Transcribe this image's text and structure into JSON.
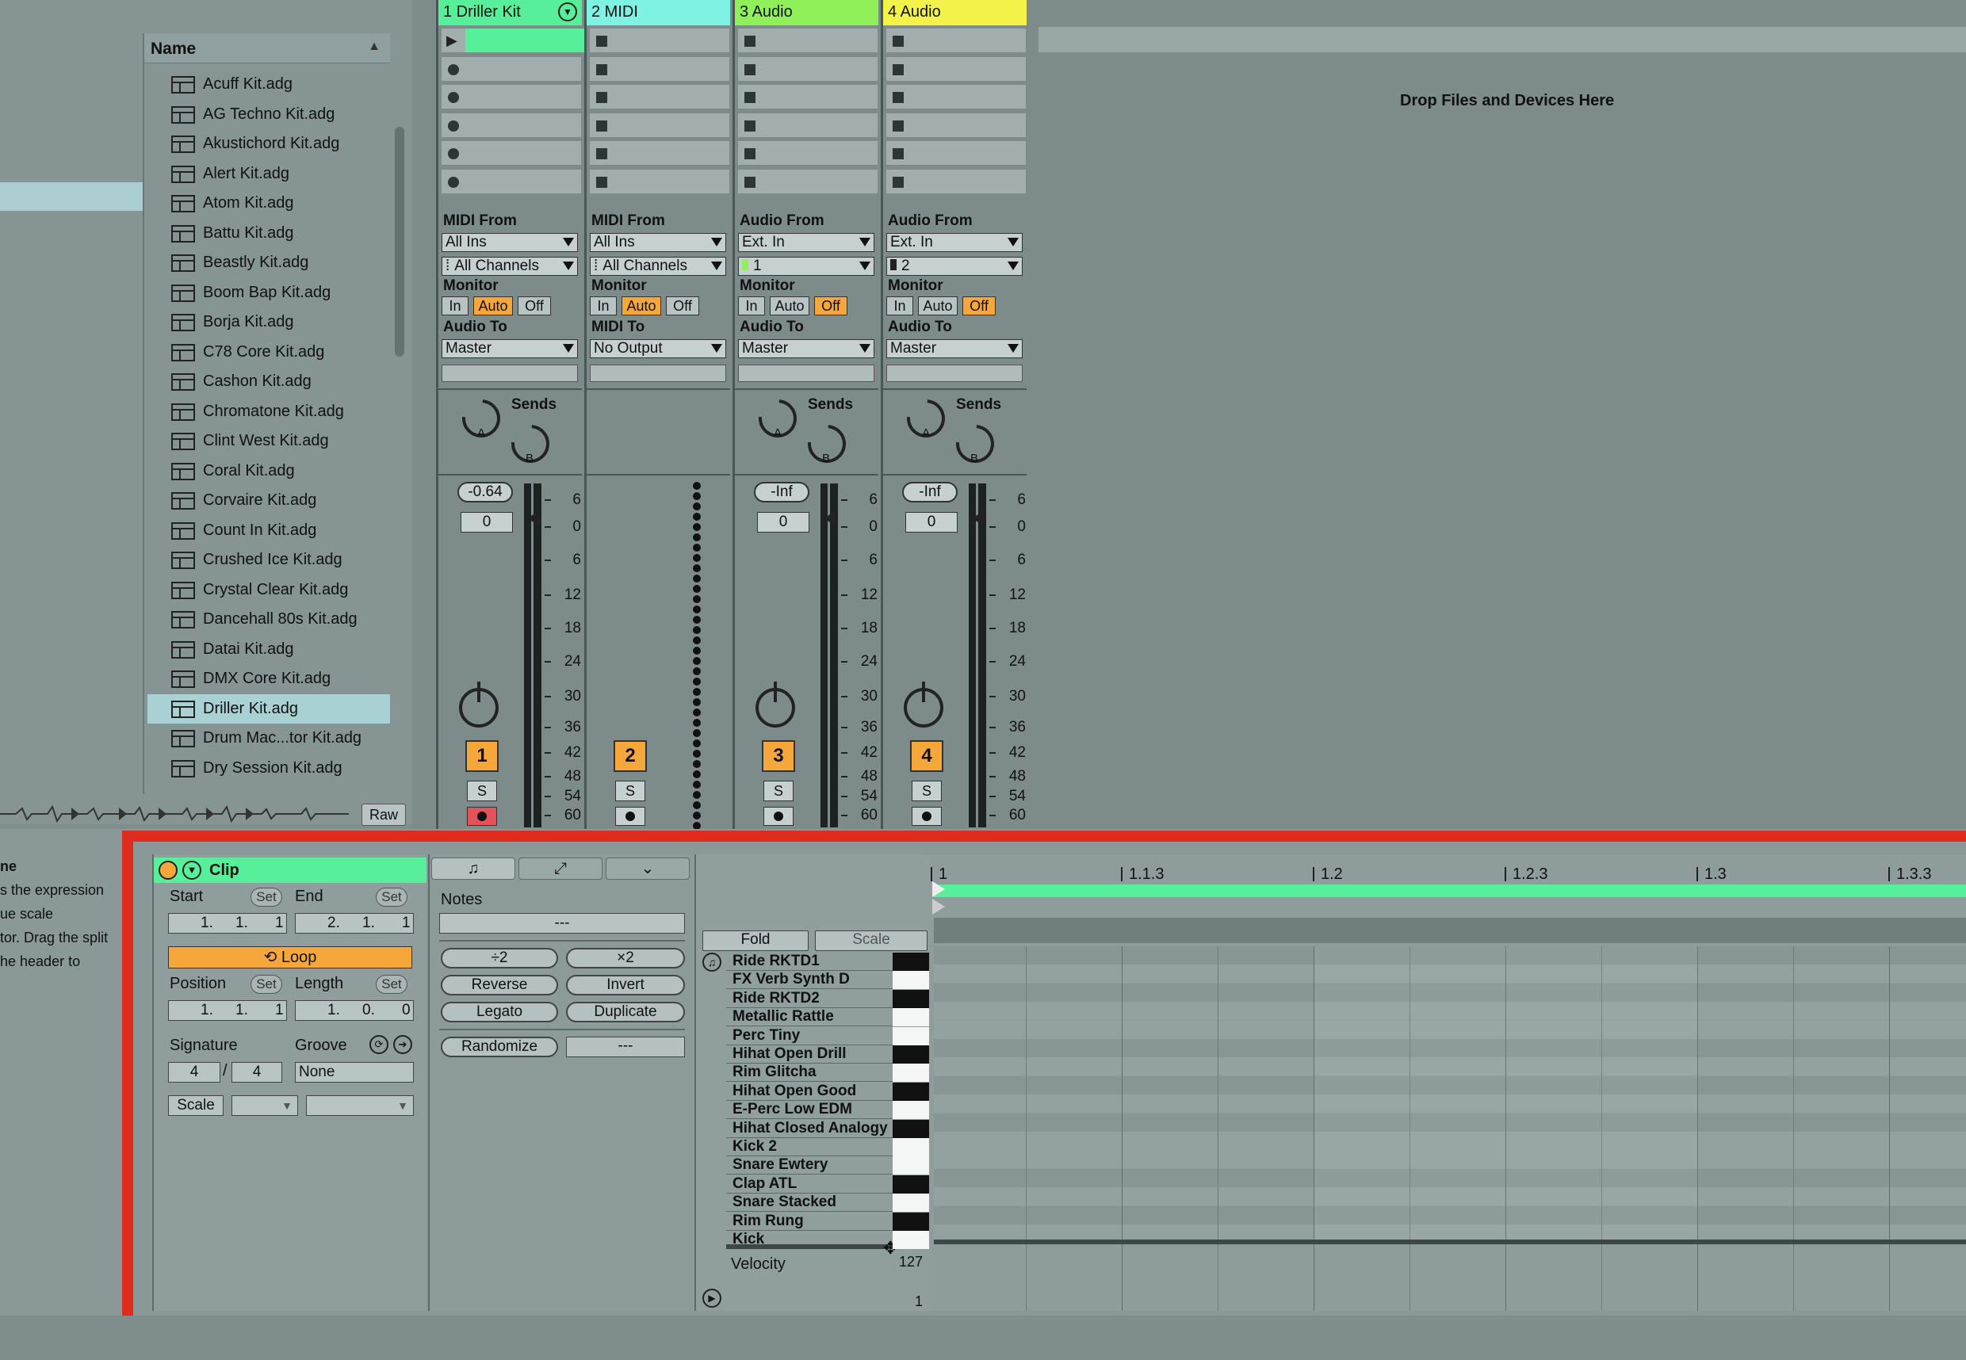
{
  "browser": {
    "column_header": "Name",
    "sort_icon": "triangle-up",
    "items": [
      "Acuff Kit.adg",
      "AG Techno Kit.adg",
      "Akustichord Kit.adg",
      "Alert Kit.adg",
      "Atom Kit.adg",
      "Battu Kit.adg",
      "Beastly Kit.adg",
      "Boom Bap Kit.adg",
      "Borja Kit.adg",
      "C78 Core Kit.adg",
      "Cashon Kit.adg",
      "Chromatone Kit.adg",
      "Clint West Kit.adg",
      "Coral Kit.adg",
      "Corvaire Kit.adg",
      "Count In Kit.adg",
      "Crushed Ice Kit.adg",
      "Crystal Clear Kit.adg",
      "Dancehall 80s Kit.adg",
      "Datai Kit.adg",
      "DMX Core Kit.adg",
      "Driller Kit.adg",
      "Drum Mac...tor Kit.adg",
      "Dry Session Kit.adg"
    ],
    "selected_item": "Driller Kit.adg",
    "raw_button": "Raw"
  },
  "tracks": [
    {
      "title": "1 Driller Kit",
      "color": "#58ef9b",
      "type": "midi",
      "from_label": "MIDI From",
      "from_value": "All Ins",
      "channel_value": "All Channels",
      "monitor_label": "Monitor",
      "monitor": [
        "In",
        "Auto",
        "Off"
      ],
      "monitor_active": "Auto",
      "to_label": "Audio To",
      "to_value": "Master",
      "sends_label": "Sends",
      "volume": "-0.64",
      "pan": "0",
      "number": "1",
      "solo": "S",
      "armed": true
    },
    {
      "title": "2 MIDI",
      "color": "#7ff3e3",
      "type": "midi",
      "from_label": "MIDI From",
      "from_value": "All Ins",
      "channel_value": "All Channels",
      "monitor_label": "Monitor",
      "monitor": [
        "In",
        "Auto",
        "Off"
      ],
      "monitor_active": "Auto",
      "to_label": "MIDI To",
      "to_value": "No Output",
      "number": "2",
      "solo": "S",
      "armed": false
    },
    {
      "title": "3 Audio",
      "color": "#8ff05a",
      "type": "audio",
      "from_label": "Audio From",
      "from_value": "Ext. In",
      "channel_value": "1",
      "monitor_label": "Monitor",
      "monitor": [
        "In",
        "Auto",
        "Off"
      ],
      "monitor_active": "Off",
      "to_label": "Audio To",
      "to_value": "Master",
      "sends_label": "Sends",
      "volume": "-Inf",
      "pan": "0",
      "number": "3",
      "solo": "S",
      "armed": false
    },
    {
      "title": "4 Audio",
      "color": "#f2f24a",
      "type": "audio",
      "from_label": "Audio From",
      "from_value": "Ext. In",
      "channel_value": "2",
      "monitor_label": "Monitor",
      "monitor": [
        "In",
        "Auto",
        "Off"
      ],
      "monitor_active": "Off",
      "to_label": "Audio To",
      "to_value": "Master",
      "sends_label": "Sends",
      "volume": "-Inf",
      "pan": "0",
      "number": "4",
      "solo": "S",
      "armed": false
    }
  ],
  "send_knobs": [
    "A",
    "B"
  ],
  "meter_scale": [
    "6",
    "0",
    "6",
    "12",
    "18",
    "24",
    "30",
    "36",
    "42",
    "48",
    "54",
    "60"
  ],
  "drop_area": {
    "text": "Drop Files and Devices Here"
  },
  "info": {
    "lines": [
      "ne",
      "s the expression",
      "ue scale",
      "tor. Drag the split",
      "he header to"
    ]
  },
  "clip": {
    "title": "Clip",
    "start_label": "Start",
    "end_label": "End",
    "set_label": "Set",
    "start_value": [
      "1.",
      "1.",
      "1"
    ],
    "end_value": [
      "2.",
      "1.",
      "1"
    ],
    "loop_label": "Loop",
    "position_label": "Position",
    "length_label": "Length",
    "position_value": [
      "1.",
      "1.",
      "1"
    ],
    "length_value": [
      "1.",
      "0.",
      "0"
    ],
    "signature_label": "Signature",
    "groove_label": "Groove",
    "sig_num": "4",
    "sig_den": "4",
    "groove_value": "None",
    "scale_label": "Scale"
  },
  "notes": {
    "label": "Notes",
    "field": "---",
    "buttons": [
      "÷2",
      "×2",
      "Reverse",
      "Invert",
      "Legato",
      "Duplicate",
      "Randomize",
      "---"
    ]
  },
  "drum_rack": {
    "fold_label": "Fold",
    "scale_label": "Scale",
    "pads": [
      {
        "name": "Ride RKTD1",
        "key": "black"
      },
      {
        "name": "FX Verb Synth D",
        "key": "white"
      },
      {
        "name": "Ride RKTD2",
        "key": "black"
      },
      {
        "name": "Metallic Rattle",
        "key": "white"
      },
      {
        "name": "Perc Tiny",
        "key": "white"
      },
      {
        "name": "Hihat Open Drill",
        "key": "black"
      },
      {
        "name": "Rim Glitcha",
        "key": "white"
      },
      {
        "name": "Hihat Open Good",
        "key": "black"
      },
      {
        "name": "E-Perc Low EDM",
        "key": "white"
      },
      {
        "name": "Hihat Closed Analogy",
        "key": "black"
      },
      {
        "name": "Kick 2",
        "key": "white"
      },
      {
        "name": "Snare Ewtery",
        "key": "white"
      },
      {
        "name": "Clap ATL",
        "key": "black"
      },
      {
        "name": "Snare Stacked",
        "key": "white"
      },
      {
        "name": "Rim Rung",
        "key": "black"
      },
      {
        "name": "Kick",
        "key": "white"
      }
    ],
    "velocity_label": "Velocity",
    "velocity_max": "127",
    "velocity_min": "1"
  },
  "ruler": [
    "1",
    "1.1.3",
    "1.2",
    "1.2.3",
    "1.3",
    "1.3.3"
  ],
  "colors": {
    "accent_orange": "#f6a73c",
    "clip_green": "#58ef9b",
    "highlight_red": "#e02c1e"
  }
}
